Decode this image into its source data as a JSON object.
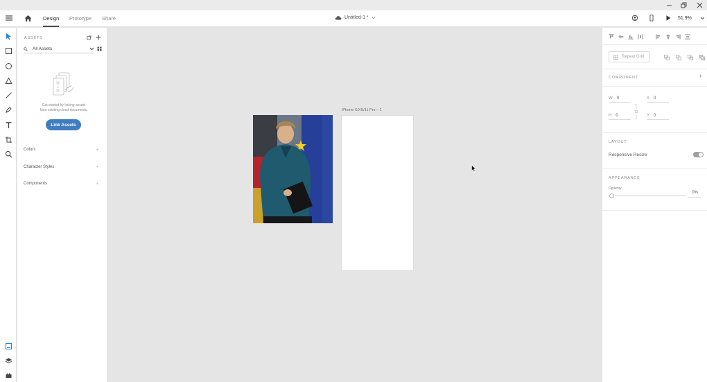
{
  "app": {
    "doc_title": "Untitled-1 *",
    "tabs": [
      {
        "label": "Design",
        "active": true
      },
      {
        "label": "Prototype",
        "active": false
      },
      {
        "label": "Share",
        "active": false
      }
    ],
    "zoom": "51.9%"
  },
  "assets": {
    "header": "ASSETS",
    "filter": "All Assets",
    "help_line1": "Get started by linking assets",
    "help_line2": "from existing cloud documents.",
    "link_button": "Link Assets",
    "sections": [
      "Colors",
      "Character Styles",
      "Components"
    ]
  },
  "props": {
    "repeat_grid": "Repeat Grid",
    "component_header": "COMPONENT",
    "fields": {
      "w_label": "W",
      "w_value": "0",
      "h_label": "H",
      "h_value": "0",
      "x_label": "X",
      "x_value": "0",
      "y_label": "Y",
      "y_value": "0"
    },
    "layout_header": "LAYOUT",
    "responsive_resize": "Responsive Resize",
    "responsive_resize_on": true,
    "appearance_header": "APPEARANCE",
    "opacity_label": "Opacity",
    "opacity_value": "0%"
  },
  "canvas": {
    "artboard_label": "iPhone X/XS/11 Pro – 1"
  },
  "colors": {
    "accent": "#3f7dc1",
    "canvas_bg": "#e5e5e5",
    "panel_bg": "#ffffff",
    "active_tool": "#2680eb"
  }
}
